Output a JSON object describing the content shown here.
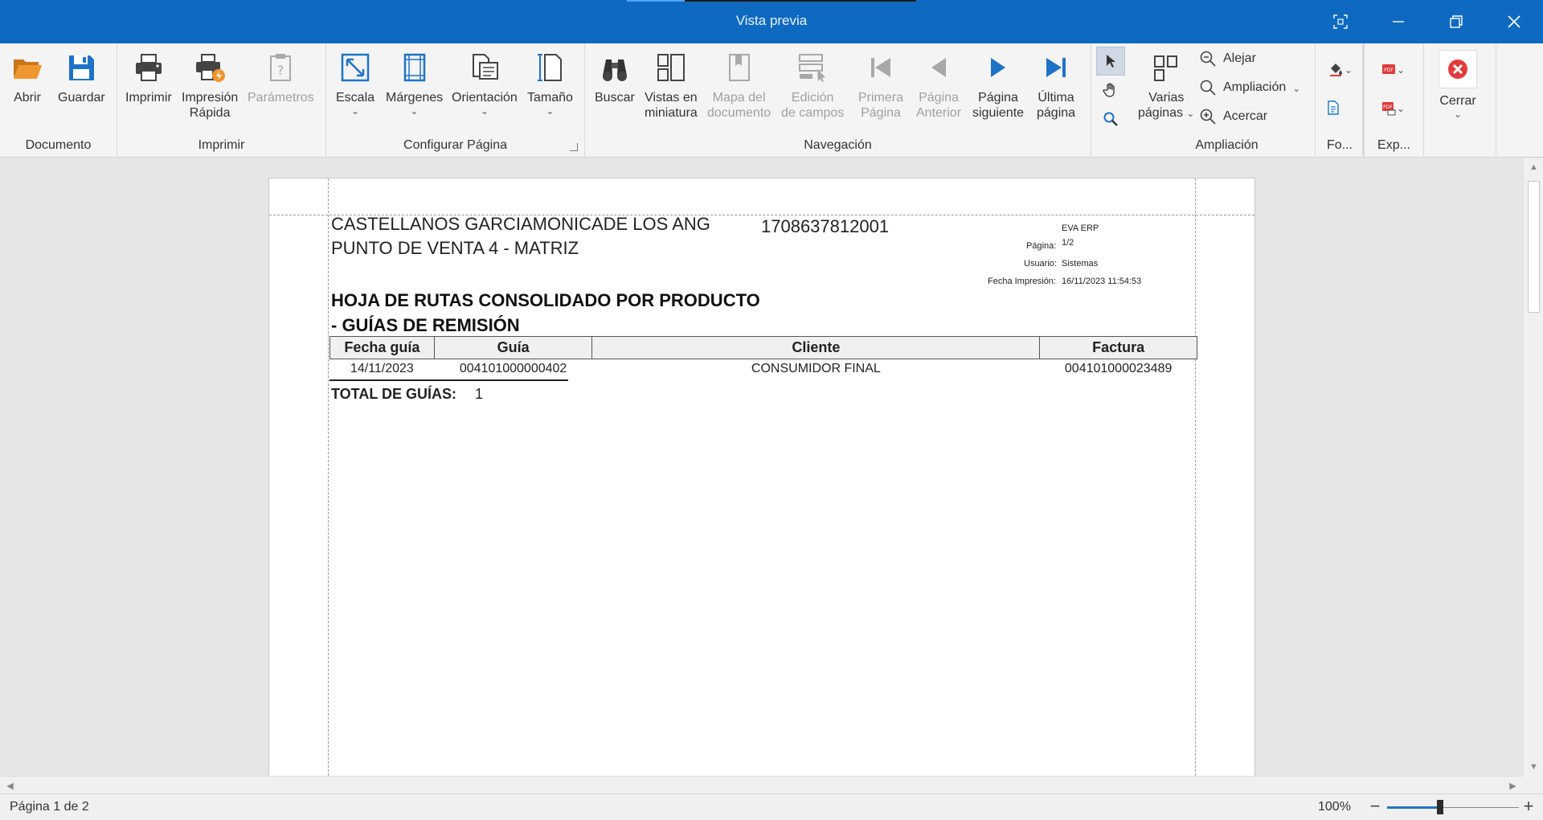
{
  "window": {
    "title": "Vista previa"
  },
  "ribbon": {
    "groups": {
      "documento": "Documento",
      "imprimir": "Imprimir",
      "configurar": "Configurar Página",
      "navegacion": "Navegación",
      "ampliacion": "Ampliación",
      "fondo": "Fo...",
      "exportar": "Exp..."
    },
    "buttons": {
      "abrir": "Abrir",
      "guardar": "Guardar",
      "imprimir": "Imprimir",
      "impresion_rapida_1": "Impresión",
      "impresion_rapida_2": "Rápida",
      "parametros": "Parámetros",
      "escala": "Escala",
      "margenes": "Márgenes",
      "orientacion": "Orientación",
      "tamano": "Tamaño",
      "buscar": "Buscar",
      "vistas_1": "Vistas en",
      "vistas_2": "miniatura",
      "mapa_1": "Mapa del",
      "mapa_2": "documento",
      "edicion_1": "Edición",
      "edicion_2": "de campos",
      "primera_1": "Primera",
      "primera_2": "Página",
      "anterior_1": "Página",
      "anterior_2": "Anterior",
      "siguiente_1": "Página",
      "siguiente_2": "siguiente",
      "ultima_1": "Última",
      "ultima_2": "página",
      "varias_1": "Varias",
      "varias_2": "páginas",
      "alejar": "Alejar",
      "ampliacion": "Ampliación",
      "acercar": "Acercar",
      "cerrar": "Cerrar"
    }
  },
  "report": {
    "company": "CASTELLANOS GARCIAMONICADE LOS ANG",
    "point_of_sale": "PUNTO DE VENTA 4 - MATRIZ",
    "ruc": "1708637812001",
    "meta": {
      "system": "EVA ERP",
      "page_label": "Página:",
      "page_value": "1/2",
      "user_label": "Usuario:",
      "user_value": "Sistemas",
      "print_label": "Fecha Impresión:",
      "print_value": "16/11/2023 11:54:53"
    },
    "title_line1": "HOJA DE RUTAS CONSOLIDADO POR PRODUCTO",
    "title_line2": "- GUÍAS DE REMISIÓN",
    "columns": [
      "Fecha guía",
      "Guía",
      "Cliente",
      "Factura"
    ],
    "rows": [
      [
        "14/11/2023",
        "004101000000402",
        "CONSUMIDOR FINAL",
        "004101000023489"
      ]
    ],
    "total_label": "TOTAL DE GUÍAS:",
    "total_value": "1"
  },
  "status": {
    "page_info": "Página 1 de 2",
    "zoom": "100%",
    "zoom_level": 0.4
  },
  "colors": {
    "titlebar": "#0e6ac0",
    "accent_blue": "#1e73c8",
    "folder_orange": "#f0962e",
    "close_red": "#e23b3b"
  }
}
